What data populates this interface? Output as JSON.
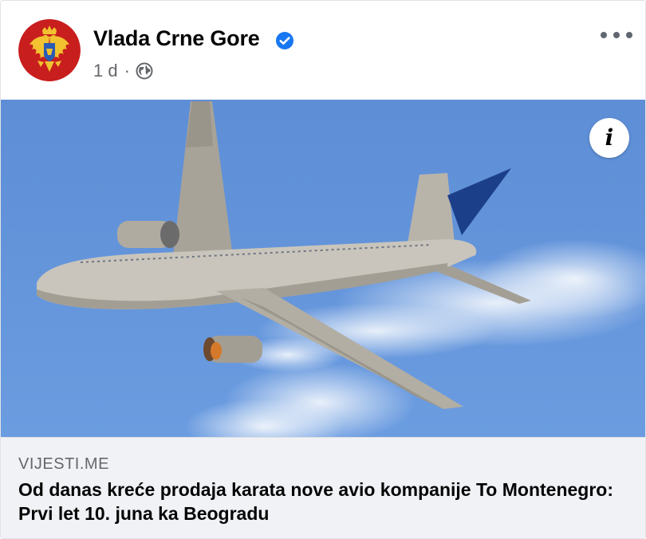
{
  "post": {
    "page_name": "Vlada Crne Gore",
    "verified_icon": "verified-badge-icon",
    "time": "1 d",
    "separator": "·",
    "audience_icon": "globe-icon",
    "more_icon": "more-options-icon",
    "info_icon": "info-icon",
    "info_label": "i"
  },
  "link_preview": {
    "source": "VIJESTI.ME",
    "headline": "Od danas kreće prodaja karata nove avio kompanije To Montenegro: Prvi let 10. juna ka Beogradu"
  },
  "colors": {
    "verified_blue": "#1877f2",
    "avatar_red": "#c81e1e",
    "sky_blue": "#5b8fd6",
    "preview_bg": "#f0f2f5"
  }
}
